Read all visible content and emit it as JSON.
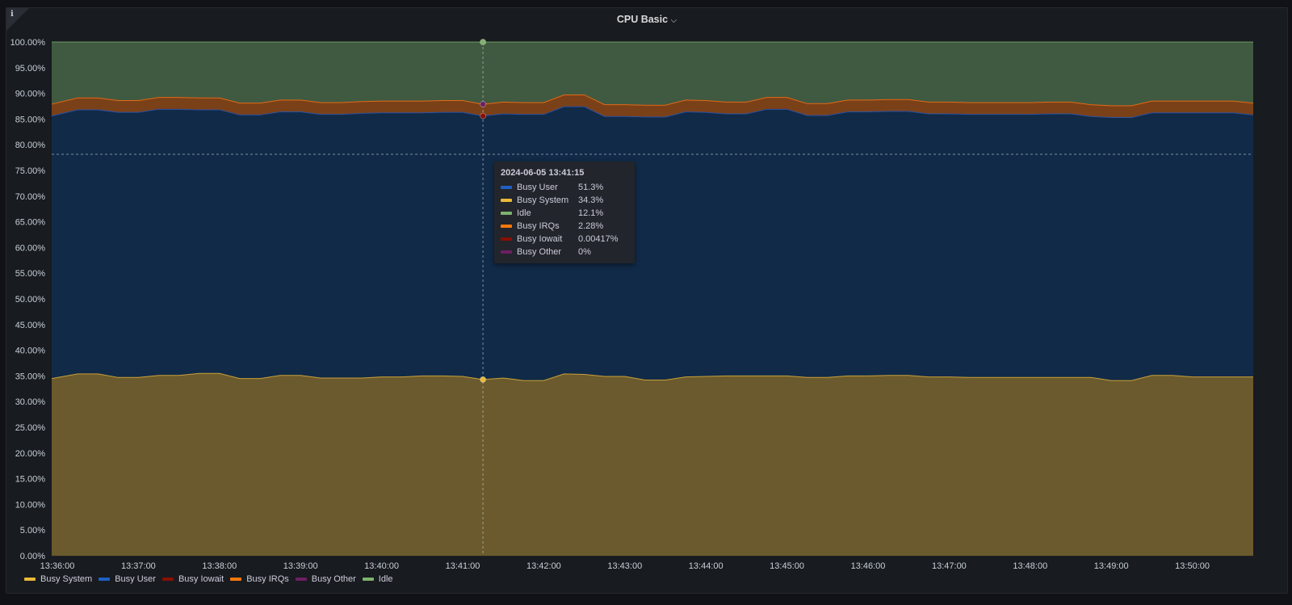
{
  "panel": {
    "title": "CPU Basic",
    "info_icon": "info-icon",
    "menu_icon": "chevron-down-icon"
  },
  "chart_data": {
    "type": "area",
    "stacked": true,
    "title": "CPU Basic",
    "xlabel": "",
    "ylabel": "",
    "ylim": [
      0,
      100
    ],
    "y_ticks": [
      "0.00%",
      "5.00%",
      "10.00%",
      "15.00%",
      "20.00%",
      "25.00%",
      "30.00%",
      "35.00%",
      "40.00%",
      "45.00%",
      "50.00%",
      "55.00%",
      "60.00%",
      "65.00%",
      "70.00%",
      "75.00%",
      "80.00%",
      "85.00%",
      "90.00%",
      "95.00%",
      "100.00%"
    ],
    "x_ticks": [
      "13:36:00",
      "13:37:00",
      "13:38:00",
      "13:39:00",
      "13:40:00",
      "13:41:00",
      "13:42:00",
      "13:43:00",
      "13:44:00",
      "13:45:00",
      "13:46:00",
      "13:47:00",
      "13:48:00",
      "13:49:00",
      "13:50:00"
    ],
    "x_start": "13:36:00",
    "x_step_seconds": 15,
    "grid": true,
    "legend_position": "bottom-left",
    "series": [
      {
        "name": "Busy System",
        "color": "#EAB839",
        "values": [
          34.5,
          35.4,
          35.4,
          34.7,
          34.7,
          35.1,
          35.1,
          35.5,
          35.5,
          34.5,
          34.5,
          35.1,
          35.1,
          34.6,
          34.6,
          34.6,
          34.8,
          34.8,
          35.0,
          35.0,
          34.9,
          34.3,
          34.6,
          34.1,
          34.1,
          35.4,
          35.3,
          34.9,
          34.9,
          34.2,
          34.2,
          34.8,
          34.9,
          35.0,
          35.0,
          35.0,
          35.0,
          34.7,
          34.7,
          35.0,
          35.0,
          35.1,
          35.1,
          34.8,
          34.8,
          34.7,
          34.7,
          34.7,
          34.7,
          34.7,
          34.7,
          34.7,
          34.1,
          34.1,
          35.1,
          35.1,
          34.8,
          34.8,
          34.8,
          34.8
        ]
      },
      {
        "name": "Busy User",
        "color": "#1F60C4",
        "values": [
          51.1,
          51.4,
          51.4,
          51.6,
          51.6,
          51.8,
          51.8,
          51.3,
          51.3,
          51.3,
          51.3,
          51.3,
          51.3,
          51.3,
          51.3,
          51.5,
          51.4,
          51.4,
          51.2,
          51.3,
          51.4,
          51.3,
          51.4,
          51.8,
          51.8,
          52.0,
          52.1,
          50.6,
          50.6,
          51.2,
          51.2,
          51.6,
          51.4,
          51.0,
          51.0,
          51.9,
          51.9,
          51.0,
          51.0,
          51.4,
          51.4,
          51.4,
          51.4,
          51.2,
          51.2,
          51.2,
          51.2,
          51.2,
          51.2,
          51.3,
          51.3,
          50.8,
          51.2,
          51.2,
          51.1,
          51.1,
          51.4,
          51.4,
          51.4,
          51.0
        ]
      },
      {
        "name": "Busy Iowait",
        "color": "#890F02",
        "values": [
          0.004
        ]
      },
      {
        "name": "Busy IRQs",
        "color": "#FF780A",
        "values": [
          2.3,
          2.3,
          2.3,
          2.3,
          2.3,
          2.3,
          2.3,
          2.3,
          2.3,
          2.3,
          2.3,
          2.3,
          2.3,
          2.3,
          2.3,
          2.3,
          2.3,
          2.3,
          2.3,
          2.3,
          2.3,
          2.28,
          2.3,
          2.3,
          2.3,
          2.3,
          2.3,
          2.3,
          2.3,
          2.3,
          2.3,
          2.3,
          2.3,
          2.3,
          2.3,
          2.3,
          2.3,
          2.3,
          2.3,
          2.3,
          2.3,
          2.3,
          2.3,
          2.3,
          2.3,
          2.3,
          2.3,
          2.3,
          2.3,
          2.3,
          2.3,
          2.3,
          2.3,
          2.3,
          2.3,
          2.3,
          2.3,
          2.3,
          2.3,
          2.3
        ]
      },
      {
        "name": "Busy Other",
        "color": "#6D1F62",
        "values": [
          0
        ]
      },
      {
        "name": "Idle",
        "color": "#7EB26D",
        "values": "remainder to 100%"
      }
    ]
  },
  "tooltip": {
    "time": "2024-06-05 13:41:15",
    "rows": [
      {
        "name": "Busy User",
        "value": "51.3%",
        "color": "#1F60C4"
      },
      {
        "name": "Busy System",
        "value": "34.3%",
        "color": "#EAB839"
      },
      {
        "name": "Idle",
        "value": "12.1%",
        "color": "#7EB26D"
      },
      {
        "name": "Busy IRQs",
        "value": "2.28%",
        "color": "#FF780A"
      },
      {
        "name": "Busy Iowait",
        "value": "0.00417%",
        "color": "#890F02"
      },
      {
        "name": "Busy Other",
        "value": "0%",
        "color": "#6D1F62"
      }
    ]
  },
  "legend": [
    {
      "name": "Busy System",
      "color": "#EAB839"
    },
    {
      "name": "Busy User",
      "color": "#1F60C4"
    },
    {
      "name": "Busy Iowait",
      "color": "#890F02"
    },
    {
      "name": "Busy IRQs",
      "color": "#FF780A"
    },
    {
      "name": "Busy Other",
      "color": "#6D1F62"
    },
    {
      "name": "Idle",
      "color": "#7EB26D"
    }
  ]
}
